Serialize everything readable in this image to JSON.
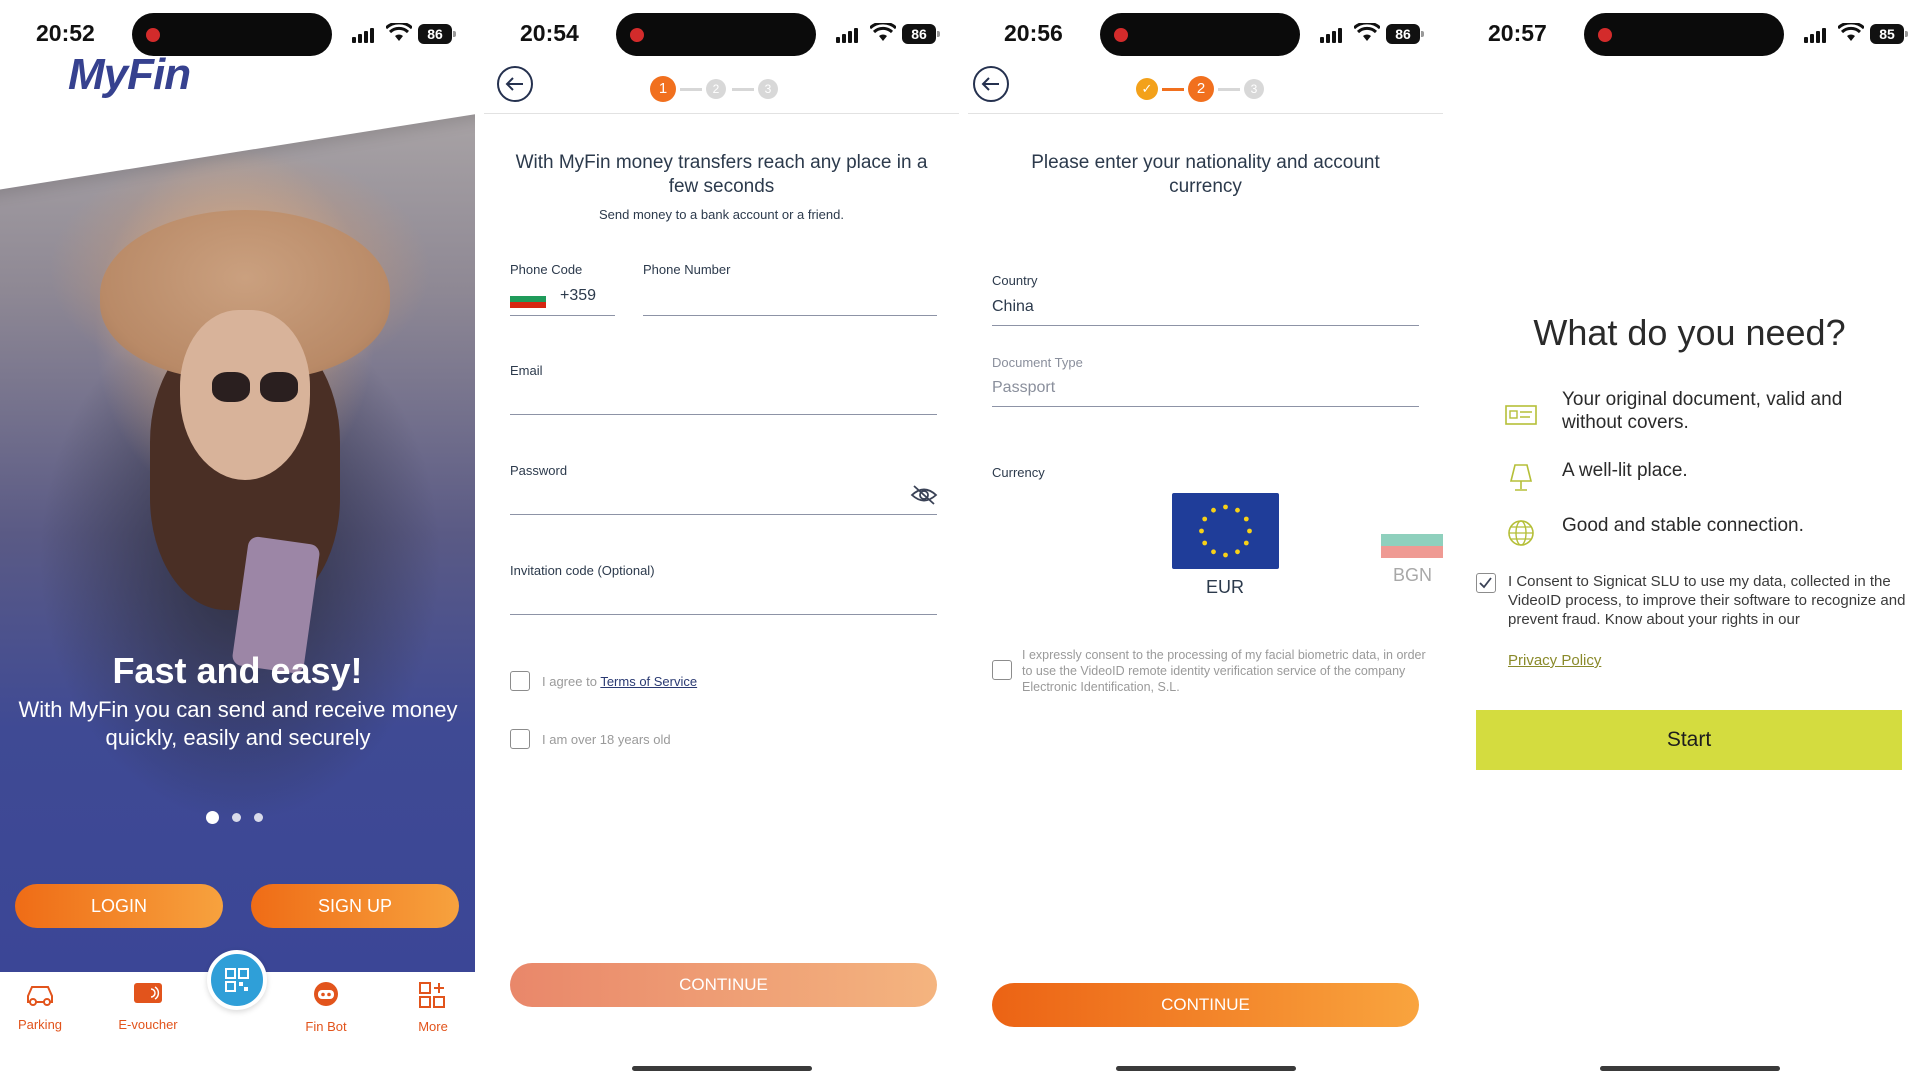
{
  "screen1": {
    "time": "20:52",
    "battery": "86",
    "logo": "MyFin",
    "title": "Fast and easy!",
    "subtitle": "With MyFin you can send and receive money quickly, easily and securely",
    "login_label": "LOGIN",
    "signup_label": "SIGN UP",
    "tabs": [
      {
        "label": "Parking",
        "icon": "car-icon"
      },
      {
        "label": "E-voucher",
        "icon": "voucher-icon"
      },
      {
        "label": "",
        "icon": "qr-code-icon"
      },
      {
        "label": "Fin Bot",
        "icon": "chatbot-icon"
      },
      {
        "label": "More",
        "icon": "grid-add-icon"
      }
    ],
    "colors": {
      "accent": "#f1701e",
      "brand": "#36418f",
      "qr": "#2f9fd8"
    }
  },
  "screen2": {
    "time": "20:54",
    "battery": "86",
    "steps": [
      "1",
      "2",
      "3"
    ],
    "heading": "With MyFin money transfers reach any place in a few seconds",
    "subheading": "Send money to a bank account or a friend.",
    "phone_code_label": "Phone Code",
    "phone_code_value": "+359",
    "phone_number_label": "Phone Number",
    "email_label": "Email",
    "password_label": "Password",
    "invitation_label": "Invitation code (Optional)",
    "agree_prefix": "I agree to ",
    "terms_link": "Terms of Service",
    "age_label": "I am over 18 years old",
    "continue_label": "CONTINUE"
  },
  "screen3": {
    "time": "20:56",
    "battery": "86",
    "steps": [
      "✓",
      "2",
      "3"
    ],
    "heading": "Please enter your nationality and account currency",
    "country_label": "Country",
    "country_value": "China",
    "doc_type_label": "Document Type",
    "doc_type_value": "Passport",
    "currency_label": "Currency",
    "currency_selected": "EUR",
    "currency_next": "BGN",
    "biometric_consent": "I expressly consent to the processing of my facial biometric data, in order to use the VideoID remote identity verification service of the company Electronic Identification, S.L.",
    "continue_label": "CONTINUE"
  },
  "screen4": {
    "time": "20:57",
    "battery": "85",
    "title": "What do you need?",
    "items": [
      {
        "text": "Your original document, valid and without covers.",
        "icon": "id-card-icon"
      },
      {
        "text": "A well-lit place.",
        "icon": "lamp-icon"
      },
      {
        "text": "Good and stable connection.",
        "icon": "globe-icon"
      }
    ],
    "consent": "I Consent to Signicat SLU to use my data, collected in the VideoID process, to improve their software to recognize and prevent fraud. Know about your rights in our",
    "privacy_link": "Privacy Policy",
    "start_label": "Start"
  }
}
